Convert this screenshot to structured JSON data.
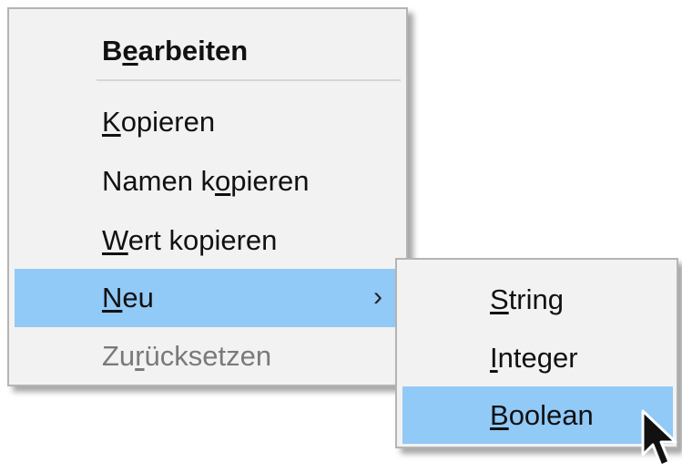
{
  "context_menu": {
    "header": {
      "pre": "B",
      "mn": "e",
      "post": "arbeiten"
    },
    "items": [
      {
        "pre": "",
        "mn": "K",
        "post": "opieren"
      },
      {
        "pre": "Namen k",
        "mn": "o",
        "post": "pieren"
      },
      {
        "pre": "",
        "mn": "W",
        "post": "ert kopieren"
      },
      {
        "pre": "",
        "mn": "N",
        "post": "eu",
        "arrow": "›"
      },
      {
        "pre": "Zu",
        "mn": "r",
        "post": "ücksetzen"
      }
    ],
    "highlight_color": "#91c9f7",
    "disabled_color": "#7a7a7a"
  },
  "submenu": {
    "items": [
      {
        "pre": "",
        "mn": "S",
        "post": "tring"
      },
      {
        "pre": "",
        "mn": "I",
        "post": "nteger"
      },
      {
        "pre": "",
        "mn": "B",
        "post": "oolean"
      }
    ]
  },
  "cursor": {
    "icon": "mouse-pointer-icon"
  }
}
